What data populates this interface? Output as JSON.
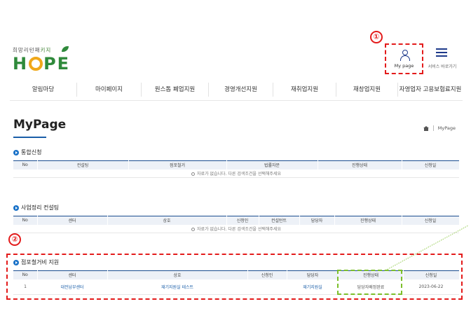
{
  "logo": {
    "sub_pre": "희망리턴패",
    "sub_accent": "키지",
    "main_pre": "H",
    "main_post": "PE"
  },
  "annotations": {
    "one": "①",
    "two": "②"
  },
  "header": {
    "mypage_label": "My page",
    "menu_label": "서비스 바로가기"
  },
  "nav": {
    "items": [
      "알림마당",
      "마이페이지",
      "원스톱 폐업지원",
      "경영개선지원",
      "재취업지원",
      "재창업지원",
      "자영업자 고용보험료지원"
    ]
  },
  "page": {
    "title": "MyPage",
    "breadcrumb": "MyPage"
  },
  "sections": {
    "integrated": {
      "title": "통합신청",
      "columns": [
        "No",
        "컨설팅",
        "점포철거",
        "법률자문",
        "진행상태",
        "신청일"
      ],
      "empty_text": "자료가 없습니다. 다른 검색조건을 선택해주세요"
    },
    "cleanup": {
      "title": "사업정리 컨설팅",
      "columns": [
        "No",
        "센터",
        "상호",
        "신청인",
        "컨설턴트",
        "담당자",
        "진행상태",
        "신청일"
      ],
      "empty_text": "자료가 없습니다. 다른 검색조건을 선택해주세요"
    },
    "demolition": {
      "title": "점포철거비 지원",
      "columns": [
        "No",
        "센터",
        "상호",
        "신청인",
        "담당자",
        "진행상태",
        "신청일"
      ],
      "rows": [
        {
          "no": "1",
          "center": "대전남부센터",
          "shop": "재기지원실 테스트",
          "applicant": "",
          "manager": "재기지원실",
          "status": "담당자배정완료",
          "date": "2023-06-22"
        }
      ]
    }
  },
  "colors": {
    "highlight_red": "#e31b1b",
    "highlight_green": "#7cbf2a",
    "brand_green": "#2f8a3b",
    "table_header_border": "#1a4d8f"
  }
}
